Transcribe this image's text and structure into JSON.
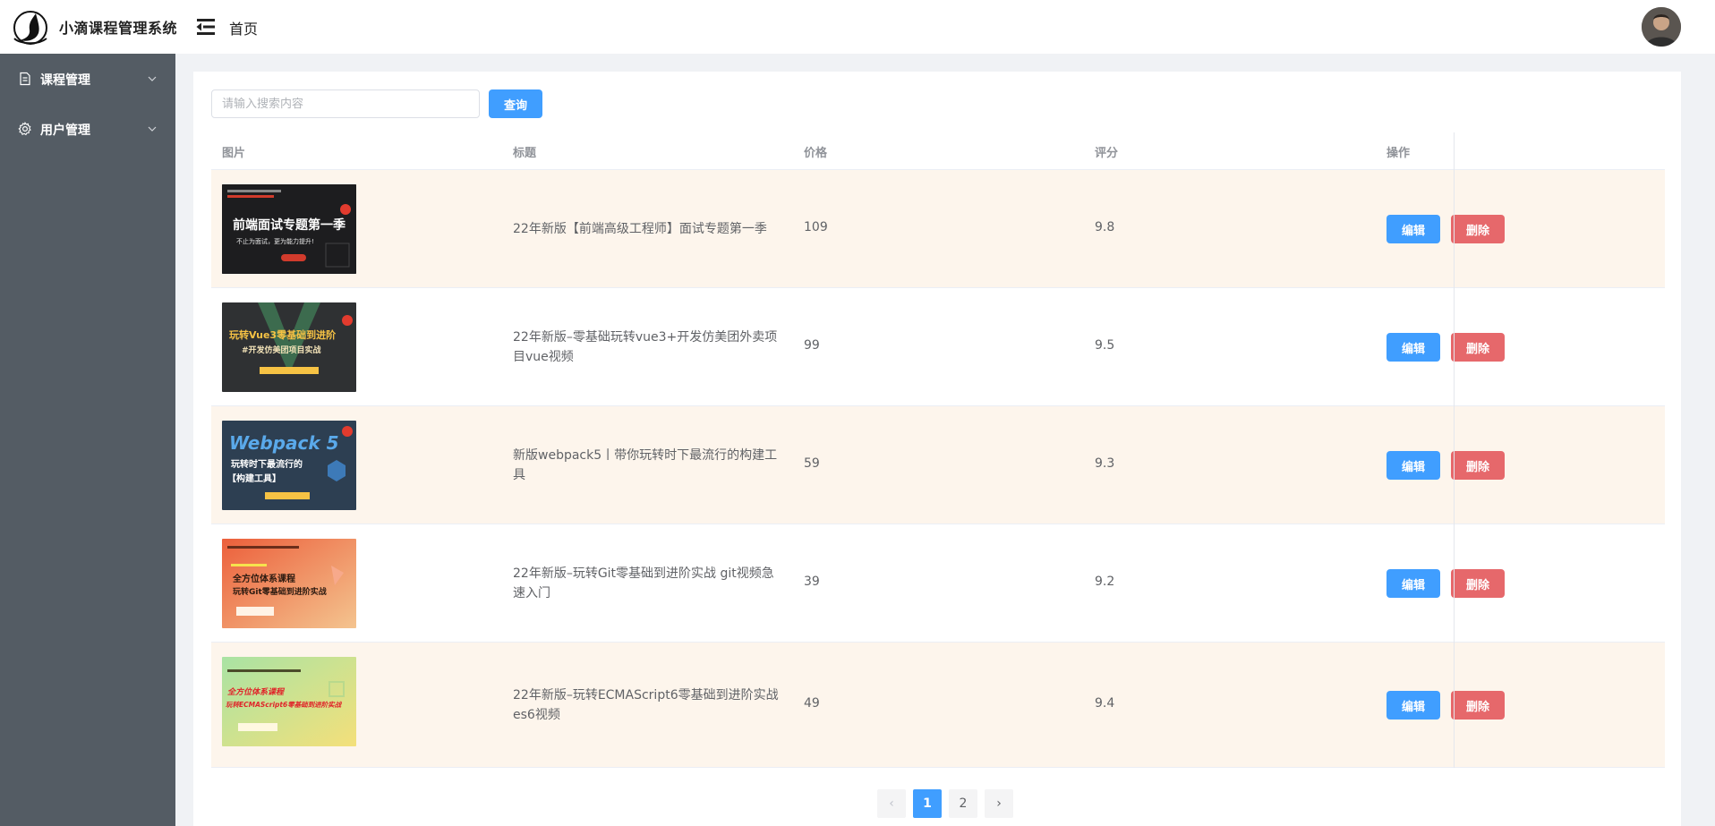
{
  "header": {
    "app_title": "小滴课程管理系统",
    "breadcrumb": "首页"
  },
  "sidebar": {
    "items": [
      {
        "label": "课程管理",
        "icon": "document-icon"
      },
      {
        "label": "用户管理",
        "icon": "gear-icon"
      }
    ]
  },
  "search": {
    "placeholder": "请输入搜索内容",
    "button_label": "查询"
  },
  "table": {
    "columns": [
      "图片",
      "标题",
      "价格",
      "评分",
      "操作"
    ],
    "rows": [
      {
        "title": "22年新版【前端高级工程师】面试专题第一季",
        "price": "109",
        "score": "9.8",
        "thumb_lines": [
          "前端面试专题第一季",
          "不止为面试，更为能力提升!"
        ]
      },
      {
        "title": "22年新版–零基础玩转vue3+开发仿美团外卖项目vue视频",
        "price": "99",
        "score": "9.5",
        "thumb_lines": [
          "玩转Vue3零基础到进阶",
          "#开发仿美团项目实战"
        ]
      },
      {
        "title": "新版webpack5丨带你玩转时下最流行的构建工具",
        "price": "59",
        "score": "9.3",
        "thumb_lines": [
          "Webpack 5",
          "玩转时下最流行的",
          "【构建工具】"
        ]
      },
      {
        "title": "22年新版–玩转Git零基础到进阶实战 git视频急速入门",
        "price": "39",
        "score": "9.2",
        "thumb_lines": [
          "全方位体系课程",
          "玩转Git零基础到进阶实战"
        ]
      },
      {
        "title": "22年新版–玩转ECMAScript6零基础到进阶实战es6视频",
        "price": "49",
        "score": "9.4",
        "thumb_lines": [
          "全方位体系课程",
          "玩转ECMAScript6零基础到进阶实战"
        ]
      }
    ],
    "edit_label": "编辑",
    "delete_label": "删除"
  },
  "pagination": {
    "pages": [
      "1",
      "2"
    ],
    "current": "1",
    "prev": "‹",
    "next": "›"
  },
  "colors": {
    "primary": "#409eff",
    "danger": "#e6686b",
    "sidebar_bg": "#545c64",
    "row_stripe": "#fdf5ec"
  }
}
